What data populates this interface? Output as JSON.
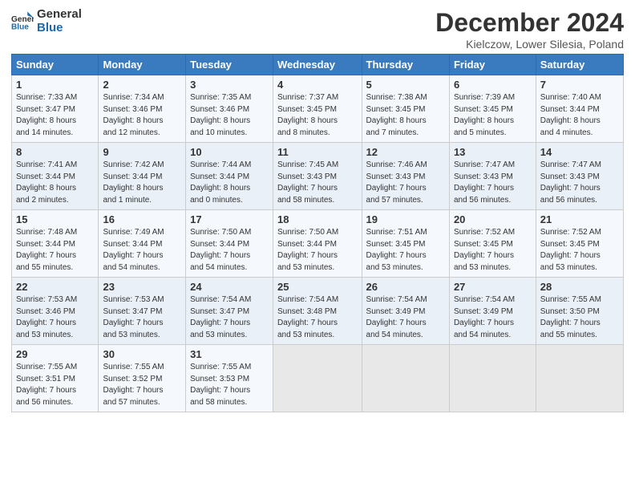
{
  "logo": {
    "line1": "General",
    "line2": "Blue"
  },
  "title": "December 2024",
  "subtitle": "Kielczow, Lower Silesia, Poland",
  "days_of_week": [
    "Sunday",
    "Monday",
    "Tuesday",
    "Wednesday",
    "Thursday",
    "Friday",
    "Saturday"
  ],
  "weeks": [
    [
      {
        "day": 1,
        "info": "Sunrise: 7:33 AM\nSunset: 3:47 PM\nDaylight: 8 hours\nand 14 minutes."
      },
      {
        "day": 2,
        "info": "Sunrise: 7:34 AM\nSunset: 3:46 PM\nDaylight: 8 hours\nand 12 minutes."
      },
      {
        "day": 3,
        "info": "Sunrise: 7:35 AM\nSunset: 3:46 PM\nDaylight: 8 hours\nand 10 minutes."
      },
      {
        "day": 4,
        "info": "Sunrise: 7:37 AM\nSunset: 3:45 PM\nDaylight: 8 hours\nand 8 minutes."
      },
      {
        "day": 5,
        "info": "Sunrise: 7:38 AM\nSunset: 3:45 PM\nDaylight: 8 hours\nand 7 minutes."
      },
      {
        "day": 6,
        "info": "Sunrise: 7:39 AM\nSunset: 3:45 PM\nDaylight: 8 hours\nand 5 minutes."
      },
      {
        "day": 7,
        "info": "Sunrise: 7:40 AM\nSunset: 3:44 PM\nDaylight: 8 hours\nand 4 minutes."
      }
    ],
    [
      {
        "day": 8,
        "info": "Sunrise: 7:41 AM\nSunset: 3:44 PM\nDaylight: 8 hours\nand 2 minutes."
      },
      {
        "day": 9,
        "info": "Sunrise: 7:42 AM\nSunset: 3:44 PM\nDaylight: 8 hours\nand 1 minute."
      },
      {
        "day": 10,
        "info": "Sunrise: 7:44 AM\nSunset: 3:44 PM\nDaylight: 8 hours\nand 0 minutes."
      },
      {
        "day": 11,
        "info": "Sunrise: 7:45 AM\nSunset: 3:43 PM\nDaylight: 7 hours\nand 58 minutes."
      },
      {
        "day": 12,
        "info": "Sunrise: 7:46 AM\nSunset: 3:43 PM\nDaylight: 7 hours\nand 57 minutes."
      },
      {
        "day": 13,
        "info": "Sunrise: 7:47 AM\nSunset: 3:43 PM\nDaylight: 7 hours\nand 56 minutes."
      },
      {
        "day": 14,
        "info": "Sunrise: 7:47 AM\nSunset: 3:43 PM\nDaylight: 7 hours\nand 56 minutes."
      }
    ],
    [
      {
        "day": 15,
        "info": "Sunrise: 7:48 AM\nSunset: 3:44 PM\nDaylight: 7 hours\nand 55 minutes."
      },
      {
        "day": 16,
        "info": "Sunrise: 7:49 AM\nSunset: 3:44 PM\nDaylight: 7 hours\nand 54 minutes."
      },
      {
        "day": 17,
        "info": "Sunrise: 7:50 AM\nSunset: 3:44 PM\nDaylight: 7 hours\nand 54 minutes."
      },
      {
        "day": 18,
        "info": "Sunrise: 7:50 AM\nSunset: 3:44 PM\nDaylight: 7 hours\nand 53 minutes."
      },
      {
        "day": 19,
        "info": "Sunrise: 7:51 AM\nSunset: 3:45 PM\nDaylight: 7 hours\nand 53 minutes."
      },
      {
        "day": 20,
        "info": "Sunrise: 7:52 AM\nSunset: 3:45 PM\nDaylight: 7 hours\nand 53 minutes."
      },
      {
        "day": 21,
        "info": "Sunrise: 7:52 AM\nSunset: 3:45 PM\nDaylight: 7 hours\nand 53 minutes."
      }
    ],
    [
      {
        "day": 22,
        "info": "Sunrise: 7:53 AM\nSunset: 3:46 PM\nDaylight: 7 hours\nand 53 minutes."
      },
      {
        "day": 23,
        "info": "Sunrise: 7:53 AM\nSunset: 3:47 PM\nDaylight: 7 hours\nand 53 minutes."
      },
      {
        "day": 24,
        "info": "Sunrise: 7:54 AM\nSunset: 3:47 PM\nDaylight: 7 hours\nand 53 minutes."
      },
      {
        "day": 25,
        "info": "Sunrise: 7:54 AM\nSunset: 3:48 PM\nDaylight: 7 hours\nand 53 minutes."
      },
      {
        "day": 26,
        "info": "Sunrise: 7:54 AM\nSunset: 3:49 PM\nDaylight: 7 hours\nand 54 minutes."
      },
      {
        "day": 27,
        "info": "Sunrise: 7:54 AM\nSunset: 3:49 PM\nDaylight: 7 hours\nand 54 minutes."
      },
      {
        "day": 28,
        "info": "Sunrise: 7:55 AM\nSunset: 3:50 PM\nDaylight: 7 hours\nand 55 minutes."
      }
    ],
    [
      {
        "day": 29,
        "info": "Sunrise: 7:55 AM\nSunset: 3:51 PM\nDaylight: 7 hours\nand 56 minutes."
      },
      {
        "day": 30,
        "info": "Sunrise: 7:55 AM\nSunset: 3:52 PM\nDaylight: 7 hours\nand 57 minutes."
      },
      {
        "day": 31,
        "info": "Sunrise: 7:55 AM\nSunset: 3:53 PM\nDaylight: 7 hours\nand 58 minutes."
      },
      null,
      null,
      null,
      null
    ]
  ]
}
